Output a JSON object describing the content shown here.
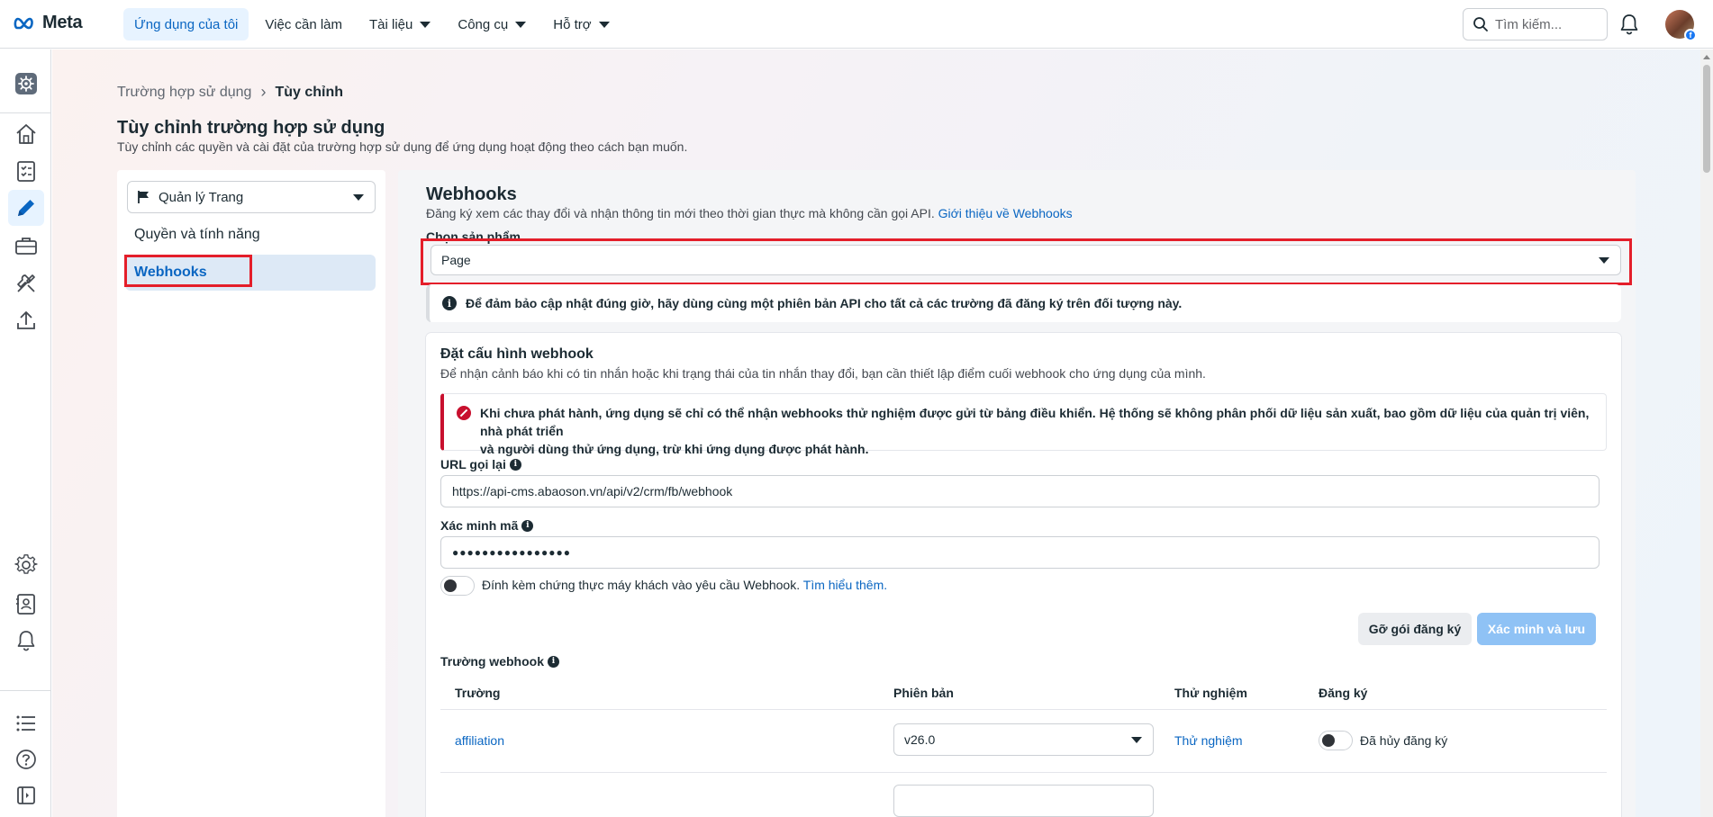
{
  "topbar": {
    "logo_text": "Meta",
    "nav": [
      {
        "label": "Ứng dụng của tôi",
        "active": true,
        "dropdown": false
      },
      {
        "label": "Việc cần làm",
        "active": false,
        "dropdown": false
      },
      {
        "label": "Tài liệu",
        "active": false,
        "dropdown": true
      },
      {
        "label": "Công cụ",
        "active": false,
        "dropdown": true
      },
      {
        "label": "Hỗ trợ",
        "active": false,
        "dropdown": true
      }
    ],
    "search_placeholder": "Tìm kiếm...",
    "avatar_badge": "f"
  },
  "rail": {
    "icons": [
      "app-settings-icon",
      "home-icon",
      "checklist-icon",
      "pencil-icon",
      "briefcase-icon",
      "tools-icon",
      "upload-icon",
      "gear-icon",
      "contacts-icon",
      "bell-icon",
      "list-icon",
      "help-icon",
      "collapse-icon"
    ],
    "active": "pencil-icon"
  },
  "breadcrumb": {
    "parent": "Trường hợp sử dụng",
    "separator": "›",
    "current": "Tùy chỉnh"
  },
  "page": {
    "title": "Tùy chỉnh trường hợp sử dụng",
    "subtitle": "Tùy chỉnh các quyền và cài đặt của trường hợp sử dụng để ứng dụng hoạt động theo cách bạn muốn."
  },
  "side": {
    "select_value": "Quản lý Trang",
    "items": [
      {
        "label": "Quyền và tính năng",
        "active": false
      },
      {
        "label": "Webhooks",
        "active": true
      }
    ]
  },
  "webhooks": {
    "title": "Webhooks",
    "description": "Đăng ký xem các thay đổi và nhận thông tin mới theo thời gian thực mà không cần gọi API.",
    "link": "Giới thiệu về Webhooks",
    "product_label": "Chọn sản phẩm",
    "product_value": "Page",
    "info_banner": "Để đảm bảo cập nhật đúng giờ, hãy dùng cùng một phiên bản API cho tất cả các trường đã đăng ký trên đối tượng này.",
    "info_icon": "i"
  },
  "config": {
    "title": "Đặt cấu hình webhook",
    "description": "Để nhận cảnh báo khi có tin nhắn hoặc khi trạng thái của tin nhắn thay đổi, bạn cần thiết lập điểm cuối webhook cho ứng dụng của mình.",
    "error_line1": "Khi chưa phát hành, ứng dụng sẽ chỉ có thể nhận webhooks thử nghiệm được gửi từ bảng điều khiển. Hệ thống sẽ không phân phối dữ liệu sản xuất, bao gồm dữ liệu của quản trị viên, nhà phát triển",
    "error_line2": "và người dùng thử ứng dụng, trừ khi ứng dụng được phát hành.",
    "callback_label": "URL gọi lại",
    "callback_value": "https://api-cms.abaoson.vn/api/v2/crm/fb/webhook",
    "verify_label": "Xác minh mã",
    "verify_value": "●●●●●●●●●●●●●●●●",
    "client_cert_text": "Đính kèm chứng thực máy khách vào yêu cầu Webhook.",
    "learn_more": "Tìm hiểu thêm.",
    "unsubscribe_button": "Gỡ gói đăng ký",
    "verify_save_button": "Xác minh và lưu",
    "fields_label": "Trường webhook",
    "columns": [
      "Trường",
      "Phiên bản",
      "Thử nghiệm",
      "Đăng ký"
    ],
    "rows": [
      {
        "field": "affiliation",
        "version": "v26.0",
        "test": "Thử nghiệm",
        "status": "Đã hủy đăng ký"
      }
    ]
  },
  "colors": {
    "accent": "#0a66c2",
    "highlight_box": "#e41e2a",
    "error": "#c8102e"
  }
}
